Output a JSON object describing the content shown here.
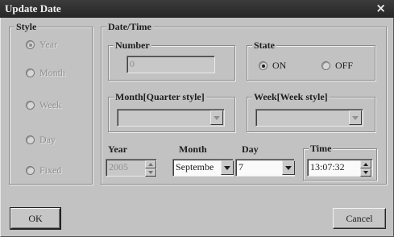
{
  "window": {
    "title": "Update Date",
    "close_glyph": "×"
  },
  "style_group": {
    "title": "Style",
    "options": [
      {
        "label": "Year",
        "checked": true
      },
      {
        "label": "Month",
        "checked": false
      },
      {
        "label": "Week",
        "checked": false
      },
      {
        "label": "Day",
        "checked": false
      },
      {
        "label": "Fixed",
        "checked": false
      }
    ]
  },
  "datetime_group": {
    "title": "Date/Time",
    "number": {
      "title": "Number",
      "value": "0"
    },
    "state": {
      "title": "State",
      "on_label": "ON",
      "off_label": "OFF",
      "selected": "ON"
    },
    "month_quarter": {
      "title": "Month[Quarter style]",
      "value": ""
    },
    "week_week": {
      "title": "Week[Week style]",
      "value": ""
    },
    "year": {
      "label": "Year",
      "value": "2005"
    },
    "month": {
      "label": "Month",
      "value": "Septembe"
    },
    "day": {
      "label": "Day",
      "value": "7"
    },
    "time": {
      "title": "Time",
      "value": "13:07:32"
    }
  },
  "buttons": {
    "ok": "OK",
    "cancel": "Cancel"
  },
  "icons": {
    "close": "close-icon",
    "dropdown": "chevron-down-icon",
    "spin_up": "arrow-up-icon",
    "spin_down": "arrow-down-icon"
  }
}
